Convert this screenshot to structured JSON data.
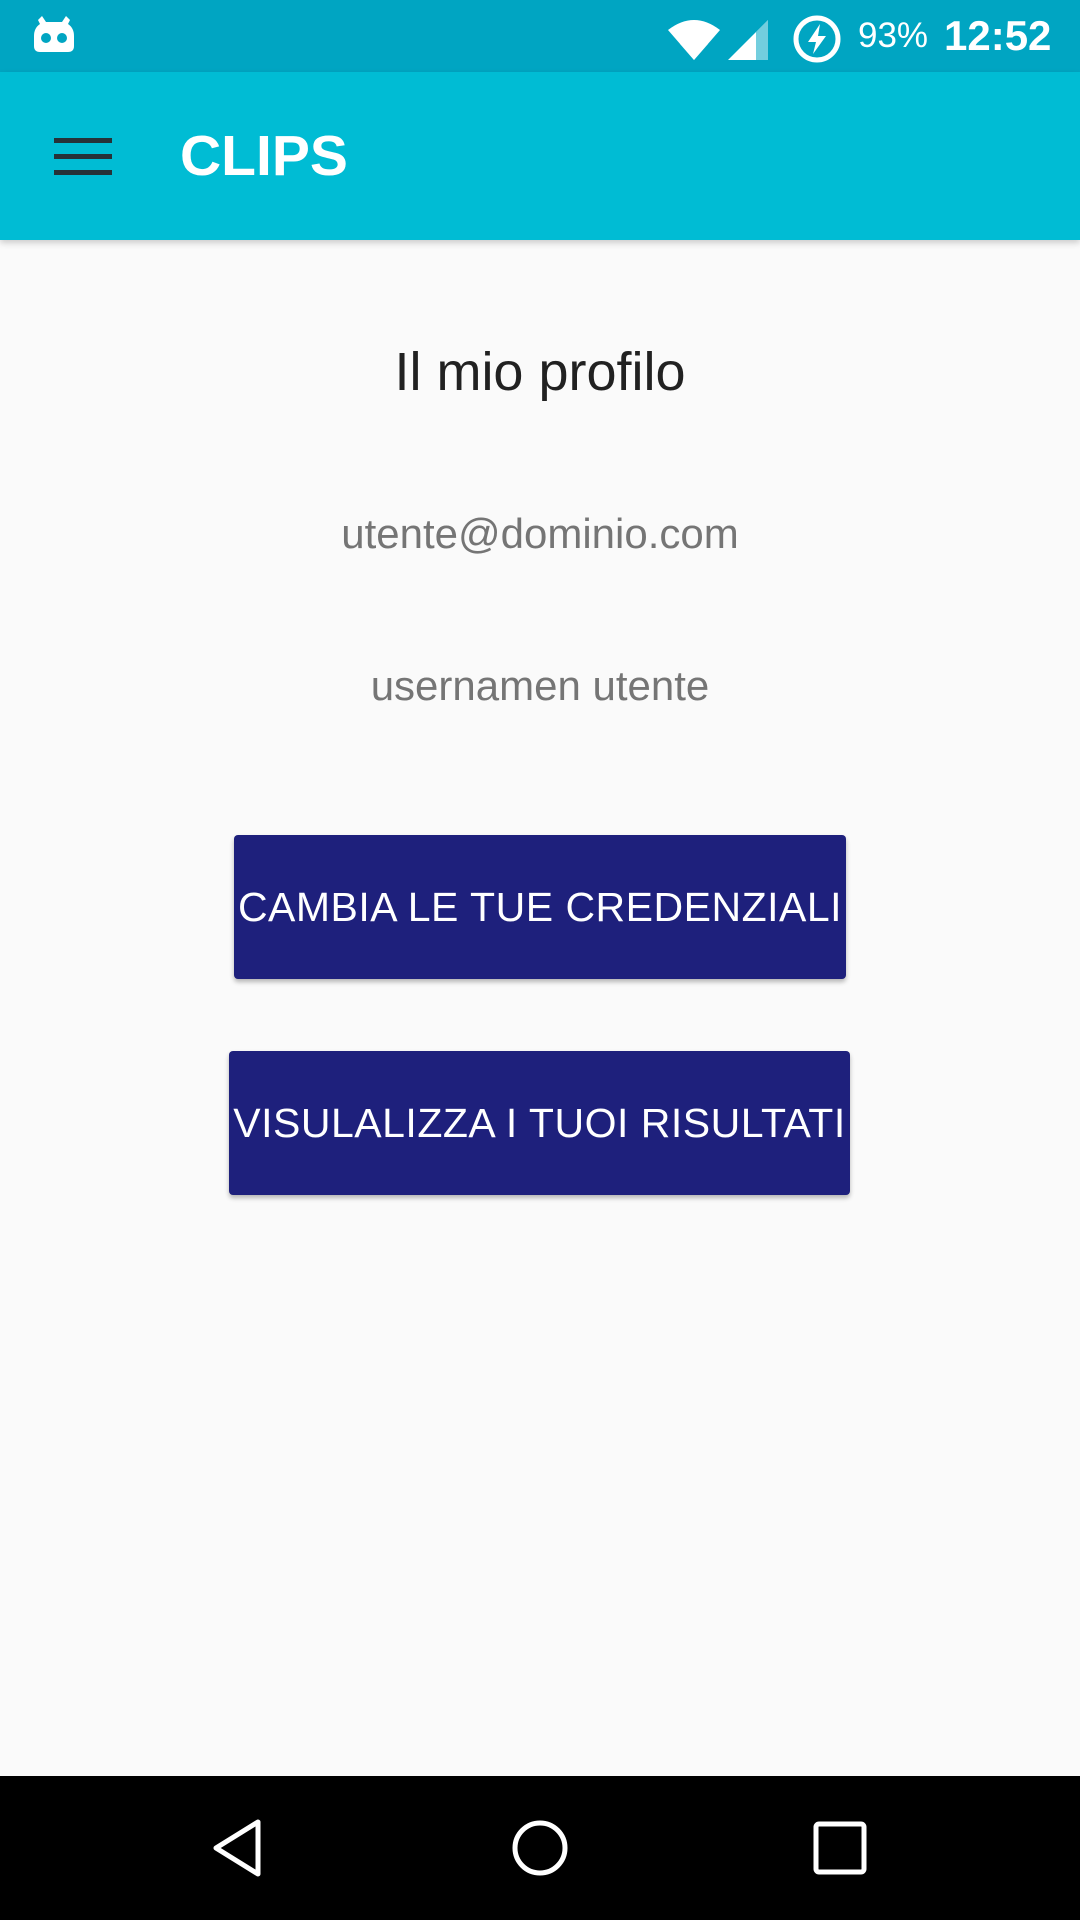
{
  "status_bar": {
    "battery_percent": "93%",
    "time": "12:52",
    "icons": [
      "cyanogenmod-icon",
      "wifi-icon",
      "signal-icon",
      "battery-charging-icon"
    ]
  },
  "app_bar": {
    "title": "CLIPS",
    "menu_icon": "hamburger-menu-icon"
  },
  "profile": {
    "heading": "Il mio profilo",
    "email": "utente@dominio.com",
    "username": "usernamen utente"
  },
  "buttons": {
    "change_credentials": "CAMBIA LE TUE CREDENZIALI",
    "view_results": "VISULALIZZA I TUOI RISULTATI"
  },
  "navigation": {
    "icons": [
      "back-icon",
      "home-icon",
      "recents-icon"
    ]
  },
  "colors": {
    "status_bar": "#00a5c2",
    "app_bar": "#00bcd4",
    "button": "#1e207c",
    "background": "#fafafa"
  }
}
